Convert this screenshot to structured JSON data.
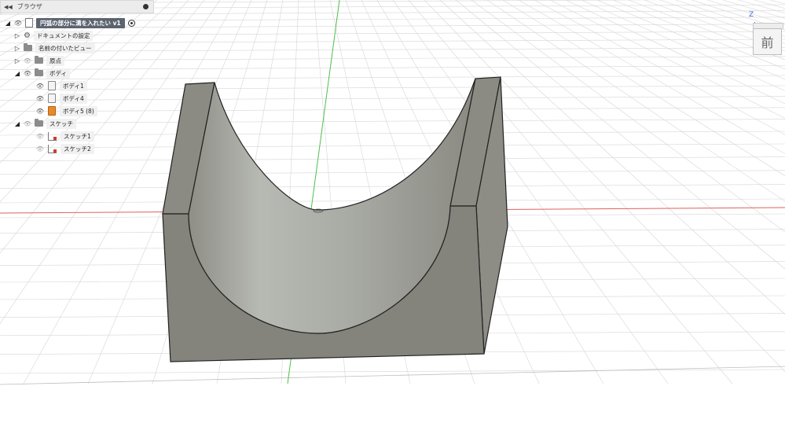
{
  "browser": {
    "header_title": "ブラウザ",
    "items": [
      {
        "label": "円弧の部分に溝を入れたい v1",
        "type": "root"
      },
      {
        "label": "ドキュメントの設定",
        "type": "settings"
      },
      {
        "label": "名前の付いたビュー",
        "type": "folder"
      },
      {
        "label": "原点",
        "type": "folder"
      },
      {
        "label": "ボディ",
        "type": "folder"
      },
      {
        "label": "ボディ1",
        "type": "body"
      },
      {
        "label": "ボディ4",
        "type": "body"
      },
      {
        "label": "ボディ5 (8)",
        "type": "body-orange"
      },
      {
        "label": "スケッチ",
        "type": "folder"
      },
      {
        "label": "スケッチ1",
        "type": "sketch"
      },
      {
        "label": "スケッチ2",
        "type": "sketch"
      }
    ]
  },
  "viewcube": {
    "face_label": "前",
    "axis_label": "Z"
  },
  "colors": {
    "model_fill": "#8a8a82",
    "model_edge": "#222222",
    "grid_line": "#d4d4d4",
    "x_axis": "#e06060",
    "y_axis": "#4cc04c",
    "z_axis": "#3a6ad6"
  }
}
